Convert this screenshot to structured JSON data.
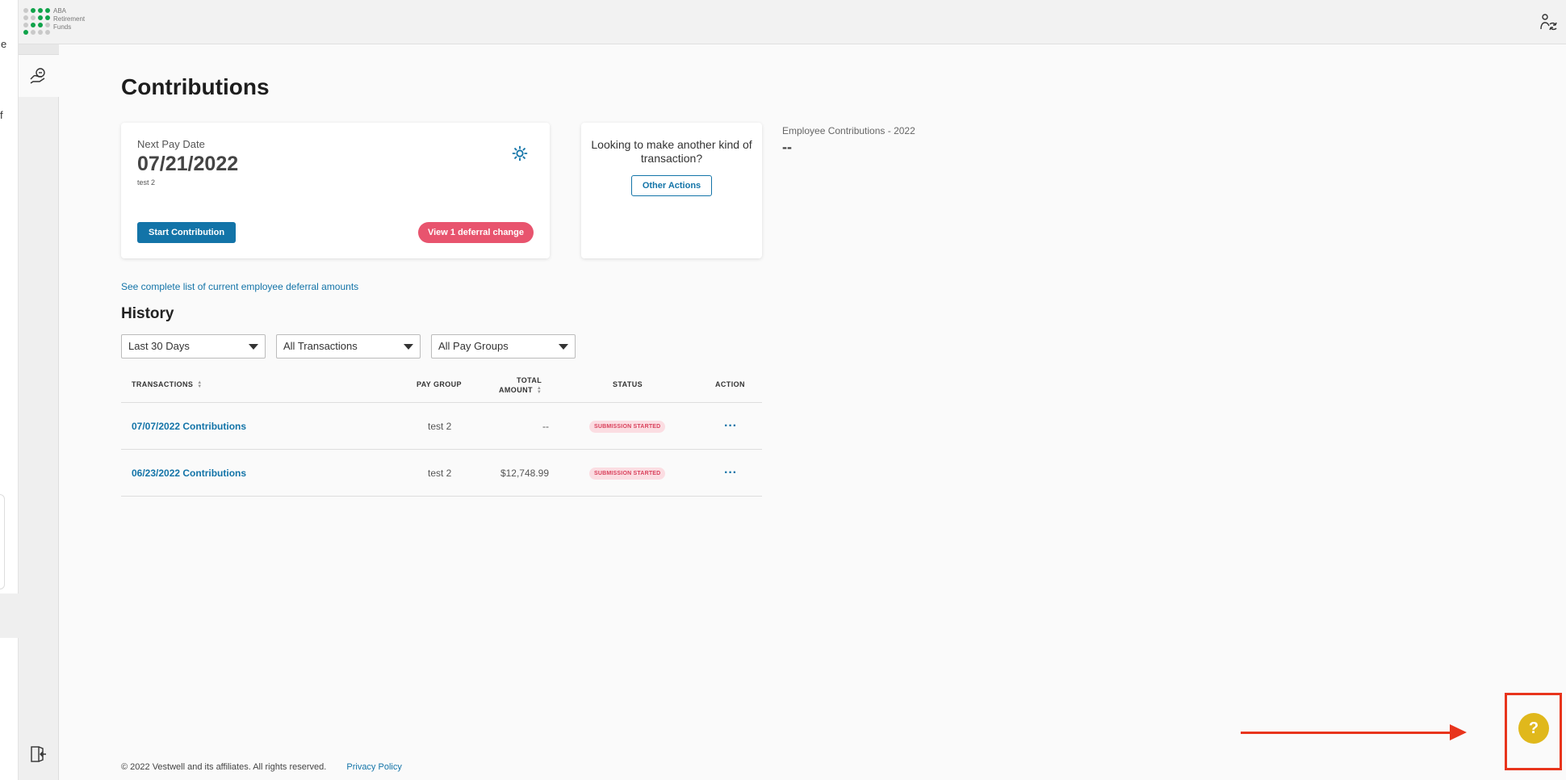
{
  "edge_fragments": [
    "e",
    "f"
  ],
  "logo": {
    "lines": [
      "ABA",
      "Retirement",
      "Funds"
    ]
  },
  "page": {
    "title": "Contributions"
  },
  "pay_card": {
    "label": "Next Pay Date",
    "date": "07/21/2022",
    "pay_group": "test 2",
    "start_button": "Start Contribution",
    "deferral_button": "View 1 deferral change",
    "settings_icon": "gear-icon"
  },
  "other_card": {
    "question": "Looking to make another kind of transaction?",
    "button": "Other Actions"
  },
  "employee_contributions": {
    "label": "Employee Contributions - 2022",
    "value": "--"
  },
  "deferral_link": "See complete list of current employee deferral amounts",
  "history": {
    "title": "History",
    "filters": {
      "range": "Last 30 Days",
      "type": "All Transactions",
      "pay_groups": "All Pay Groups"
    },
    "columns": {
      "transactions": "TRANSACTIONS",
      "pay_group": "PAY GROUP",
      "total_amount_1": "TOTAL",
      "total_amount_2": "AMOUNT",
      "status": "STATUS",
      "action": "ACTION"
    },
    "rows": [
      {
        "transaction": "07/07/2022 Contributions",
        "pay_group": "test 2",
        "amount": "--",
        "status": "SUBMISSION STARTED",
        "action": "···"
      },
      {
        "transaction": "06/23/2022 Contributions",
        "pay_group": "test 2",
        "amount": "$12,748.99",
        "status": "SUBMISSION STARTED",
        "action": "···"
      }
    ]
  },
  "footer": {
    "copyright": "© 2022 Vestwell and its affiliates. All rights reserved.",
    "privacy": "Privacy Policy"
  },
  "help": {
    "label": "?"
  },
  "colors": {
    "accent": "#1374a8",
    "alert": "#e8546e",
    "help": "#e0b81c",
    "annotation": "#e8341c"
  }
}
